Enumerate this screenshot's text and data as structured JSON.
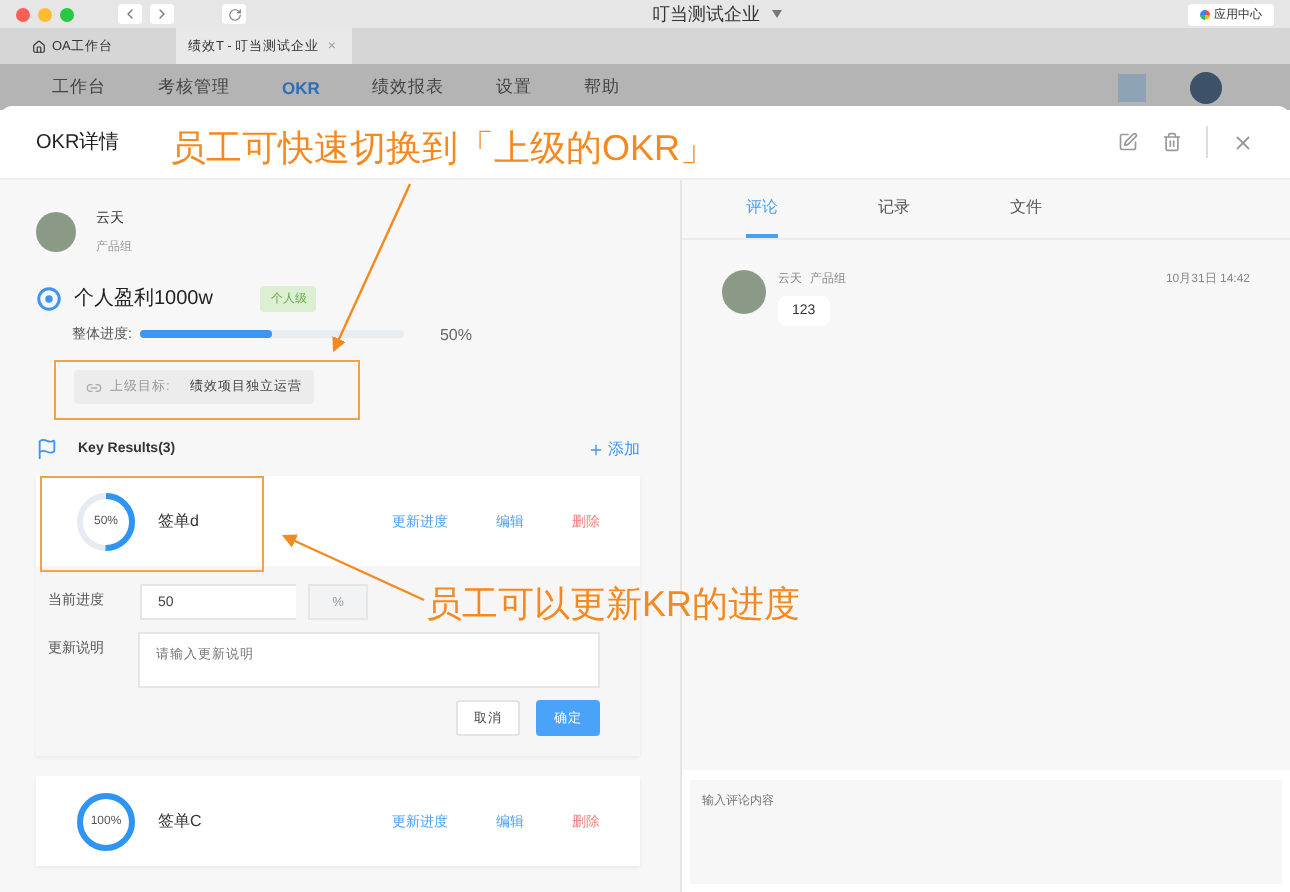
{
  "browser": {
    "title": "叮当测试企业",
    "app_center": "应用中心",
    "tabs": [
      {
        "label": "OA工作台",
        "selected": false
      },
      {
        "label": "绩效T - 叮当测试企业",
        "selected": true,
        "close": "×"
      }
    ]
  },
  "nav": {
    "items": [
      {
        "label": "工作台",
        "selected": false
      },
      {
        "label": "考核管理",
        "selected": false
      },
      {
        "label": "OKR",
        "selected": true
      },
      {
        "label": "绩效报表",
        "selected": false
      },
      {
        "label": "设置",
        "selected": false
      },
      {
        "label": "帮助",
        "selected": false
      }
    ]
  },
  "modal": {
    "title": "OKR详情"
  },
  "owner": {
    "name": "云天",
    "dept": "产品组"
  },
  "objective": {
    "title": "个人盈利1000w",
    "tag": "个人级",
    "progress_label": "整体进度:",
    "level": 0.5,
    "reading": "50%",
    "parent_label": "上级目标:",
    "parent_value": "绩效项目独立运营"
  },
  "key_results": {
    "title": "Key Results(3)",
    "add": "添加",
    "items": [
      {
        "ring": "50%",
        "level": 0.5,
        "name": "签单d",
        "expanded": true,
        "actions": [
          {
            "label": "更新进度",
            "kind": "link"
          },
          {
            "label": "编辑",
            "kind": "link"
          },
          {
            "label": "删除",
            "kind": "danger"
          }
        ]
      },
      {
        "ring": "100%",
        "level": 1,
        "name": "签单C",
        "expanded": false,
        "actions": [
          {
            "label": "更新进度",
            "kind": "link"
          },
          {
            "label": "编辑",
            "kind": "link"
          },
          {
            "label": "删除",
            "kind": "danger"
          }
        ]
      }
    ]
  },
  "update_form": {
    "progress_label": "当前进度",
    "progress_value": "50",
    "unit": "%",
    "note_label": "更新说明",
    "note_placeholder": "请输入更新说明",
    "buttons": [
      {
        "label": "取消",
        "kind": "secondary"
      },
      {
        "label": "确定",
        "kind": "primary"
      }
    ]
  },
  "side_tabs": [
    {
      "label": "评论",
      "selected": true
    },
    {
      "label": "记录",
      "selected": false
    },
    {
      "label": "文件",
      "selected": false
    }
  ],
  "comments": [
    {
      "name": "云天",
      "dept": "产品组",
      "time": "10月31日 14:42",
      "text": "123"
    }
  ],
  "comment_input": {
    "placeholder": "输入评论内容"
  },
  "annotations": [
    {
      "text": "员工可快速切换到「上级的OKR」"
    },
    {
      "text": "员工可以更新KR的进度"
    }
  ]
}
